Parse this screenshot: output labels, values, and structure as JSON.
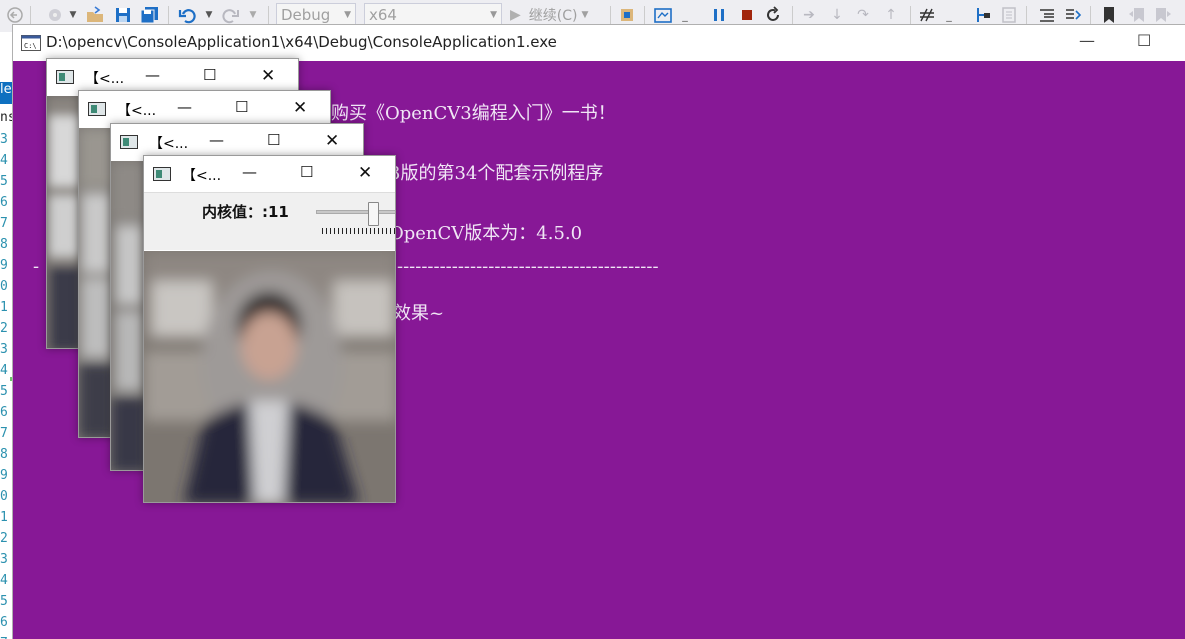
{
  "toolbar": {
    "config_combo": "Debug",
    "platform_combo": "x64",
    "continue_label": "继续(C)"
  },
  "editor": {
    "line_numbers": [
      "3",
      "4",
      "5",
      "6",
      "7",
      "8",
      "9",
      "0",
      "1",
      "2",
      "3",
      "4",
      "5",
      "6",
      "7",
      "8",
      "9",
      "0",
      "1",
      "2",
      "3",
      "4",
      "5",
      "6",
      "7"
    ],
    "tab_fragment": "le",
    "side_fragment": "ns"
  },
  "console": {
    "title": "D:\\opencv\\ConsoleApplication1\\x64\\Debug\\ConsoleApplication1.exe",
    "lines": [
      "购买《OpenCV3编程入门》一书！",
      "3版的第34个配套示例程序",
      "OpenCV版本为：4.5.0",
      "-",
      "-------------------------------------------",
      "效果~"
    ]
  },
  "cv_windows": [
    {
      "title": "【<..."
    },
    {
      "title": "【<..."
    },
    {
      "title": "【<..."
    },
    {
      "title": "【<..."
    }
  ],
  "trackbar": {
    "label": "内核值：:11",
    "value": 11
  }
}
